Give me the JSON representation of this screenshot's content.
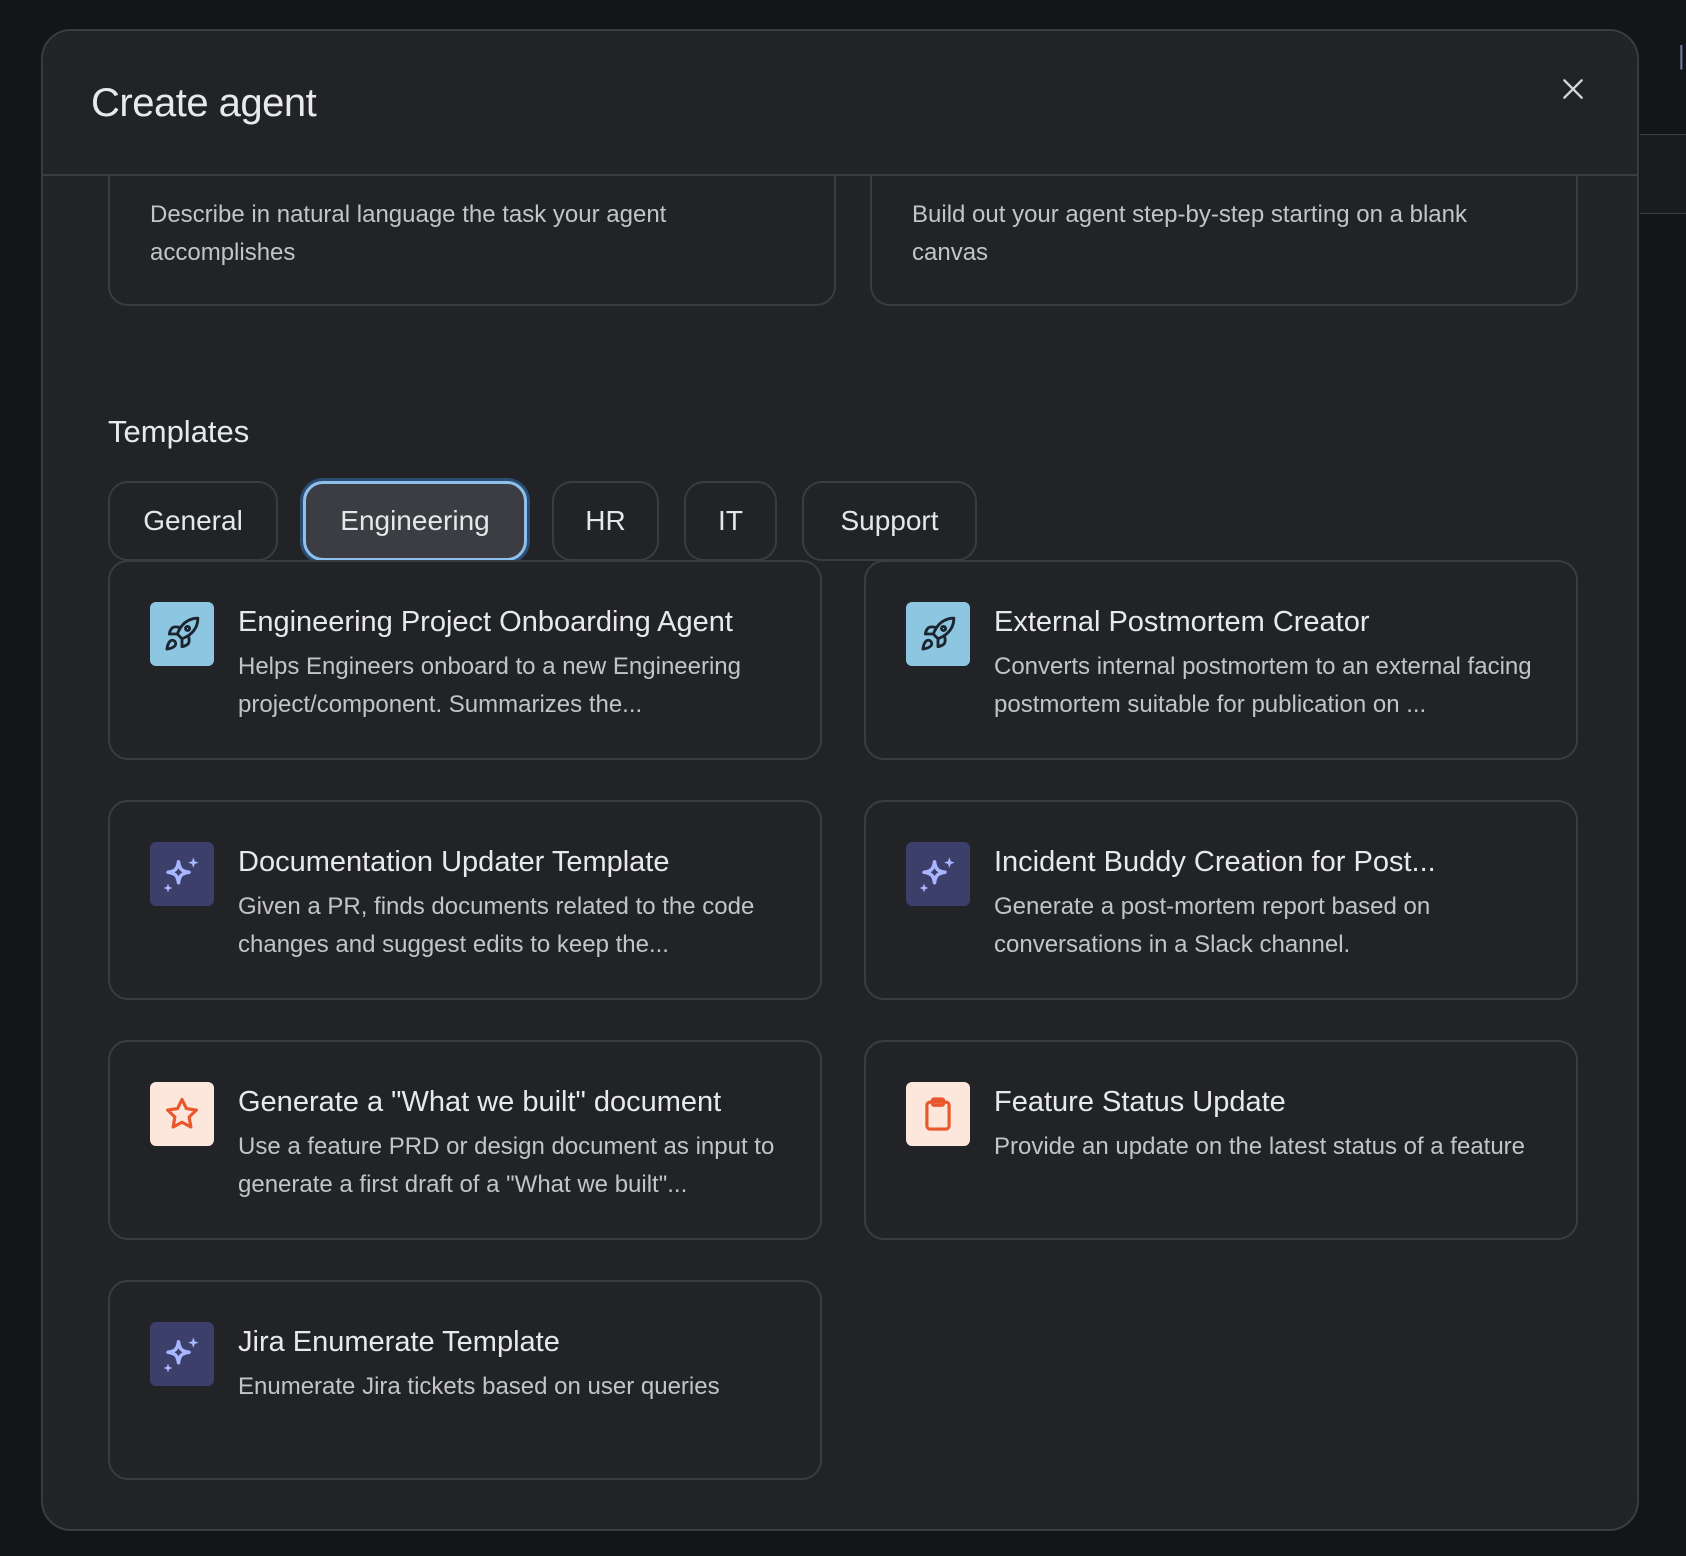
{
  "modal": {
    "title": "Create agent"
  },
  "start_options": [
    {
      "description": "Describe in natural language the task your agent accomplishes"
    },
    {
      "description": "Build out your agent step-by-step starting on a blank canvas"
    }
  ],
  "templates_section": {
    "title": "Templates",
    "tabs": [
      {
        "label": "General"
      },
      {
        "label": "Engineering"
      },
      {
        "label": "HR"
      },
      {
        "label": "IT"
      },
      {
        "label": "Support"
      }
    ],
    "active_tab": "Engineering"
  },
  "templates": [
    {
      "title": "Engineering Project Onboarding Agent",
      "description": "Helps Engineers onboard to a new Engineering project/component. Summarizes the...",
      "icon": "rocket-icon",
      "icon_bg": "#8cc6e0",
      "icon_fg": "#1b2530"
    },
    {
      "title": "External Postmortem Creator",
      "description": "Converts internal postmortem to an external facing postmortem suitable for publication on ...",
      "icon": "rocket-icon",
      "icon_bg": "#8cc6e0",
      "icon_fg": "#1b2530"
    },
    {
      "title": "Documentation Updater Template",
      "description": "Given a PR, finds documents related to the code changes and suggest edits to keep the...",
      "icon": "sparkle-icon",
      "icon_bg": "#3b3f6a",
      "icon_fg": "#a9b6ff"
    },
    {
      "title": "Incident Buddy Creation for Post...",
      "description": "Generate a post-mortem report based on conversations in a Slack channel.",
      "icon": "sparkle-icon",
      "icon_bg": "#3b3f6a",
      "icon_fg": "#a9b6ff"
    },
    {
      "title": "Generate a \"What we built\" document",
      "description": "Use a feature PRD or design document as input to generate a first draft of a \"What we built\"...",
      "icon": "star-icon",
      "icon_bg": "#fde6dc",
      "icon_fg": "#e8582c"
    },
    {
      "title": "Feature Status Update",
      "description": "Provide an update on the latest status of a feature",
      "icon": "clipboard-icon",
      "icon_bg": "#fde6dc",
      "icon_fg": "#e8582c"
    },
    {
      "title": "Jira Enumerate Template",
      "description": "Enumerate Jira tickets based on user queries",
      "icon": "sparkle-icon",
      "icon_bg": "#3b3f6a",
      "icon_fg": "#a9b6ff"
    }
  ]
}
